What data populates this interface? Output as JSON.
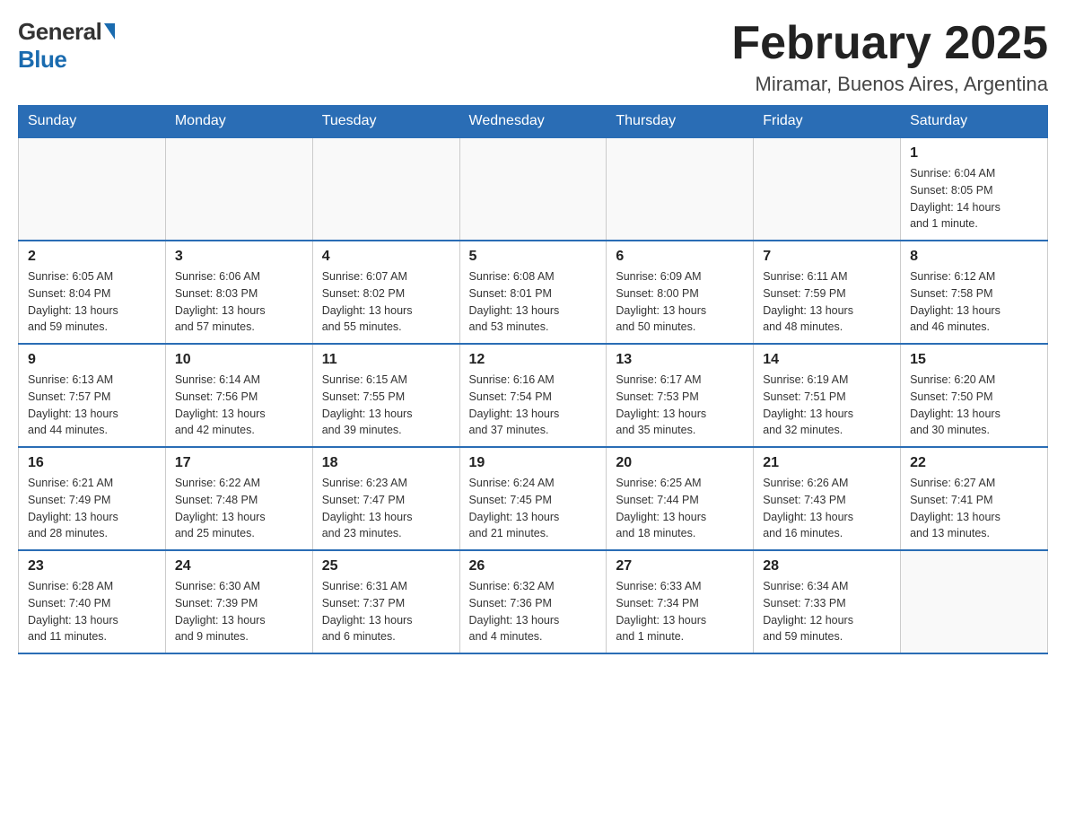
{
  "header": {
    "logo_general": "General",
    "logo_blue": "Blue",
    "month_title": "February 2025",
    "location": "Miramar, Buenos Aires, Argentina"
  },
  "days_of_week": [
    "Sunday",
    "Monday",
    "Tuesday",
    "Wednesday",
    "Thursday",
    "Friday",
    "Saturday"
  ],
  "weeks": [
    [
      {
        "day": "",
        "info": ""
      },
      {
        "day": "",
        "info": ""
      },
      {
        "day": "",
        "info": ""
      },
      {
        "day": "",
        "info": ""
      },
      {
        "day": "",
        "info": ""
      },
      {
        "day": "",
        "info": ""
      },
      {
        "day": "1",
        "info": "Sunrise: 6:04 AM\nSunset: 8:05 PM\nDaylight: 14 hours\nand 1 minute."
      }
    ],
    [
      {
        "day": "2",
        "info": "Sunrise: 6:05 AM\nSunset: 8:04 PM\nDaylight: 13 hours\nand 59 minutes."
      },
      {
        "day": "3",
        "info": "Sunrise: 6:06 AM\nSunset: 8:03 PM\nDaylight: 13 hours\nand 57 minutes."
      },
      {
        "day": "4",
        "info": "Sunrise: 6:07 AM\nSunset: 8:02 PM\nDaylight: 13 hours\nand 55 minutes."
      },
      {
        "day": "5",
        "info": "Sunrise: 6:08 AM\nSunset: 8:01 PM\nDaylight: 13 hours\nand 53 minutes."
      },
      {
        "day": "6",
        "info": "Sunrise: 6:09 AM\nSunset: 8:00 PM\nDaylight: 13 hours\nand 50 minutes."
      },
      {
        "day": "7",
        "info": "Sunrise: 6:11 AM\nSunset: 7:59 PM\nDaylight: 13 hours\nand 48 minutes."
      },
      {
        "day": "8",
        "info": "Sunrise: 6:12 AM\nSunset: 7:58 PM\nDaylight: 13 hours\nand 46 minutes."
      }
    ],
    [
      {
        "day": "9",
        "info": "Sunrise: 6:13 AM\nSunset: 7:57 PM\nDaylight: 13 hours\nand 44 minutes."
      },
      {
        "day": "10",
        "info": "Sunrise: 6:14 AM\nSunset: 7:56 PM\nDaylight: 13 hours\nand 42 minutes."
      },
      {
        "day": "11",
        "info": "Sunrise: 6:15 AM\nSunset: 7:55 PM\nDaylight: 13 hours\nand 39 minutes."
      },
      {
        "day": "12",
        "info": "Sunrise: 6:16 AM\nSunset: 7:54 PM\nDaylight: 13 hours\nand 37 minutes."
      },
      {
        "day": "13",
        "info": "Sunrise: 6:17 AM\nSunset: 7:53 PM\nDaylight: 13 hours\nand 35 minutes."
      },
      {
        "day": "14",
        "info": "Sunrise: 6:19 AM\nSunset: 7:51 PM\nDaylight: 13 hours\nand 32 minutes."
      },
      {
        "day": "15",
        "info": "Sunrise: 6:20 AM\nSunset: 7:50 PM\nDaylight: 13 hours\nand 30 minutes."
      }
    ],
    [
      {
        "day": "16",
        "info": "Sunrise: 6:21 AM\nSunset: 7:49 PM\nDaylight: 13 hours\nand 28 minutes."
      },
      {
        "day": "17",
        "info": "Sunrise: 6:22 AM\nSunset: 7:48 PM\nDaylight: 13 hours\nand 25 minutes."
      },
      {
        "day": "18",
        "info": "Sunrise: 6:23 AM\nSunset: 7:47 PM\nDaylight: 13 hours\nand 23 minutes."
      },
      {
        "day": "19",
        "info": "Sunrise: 6:24 AM\nSunset: 7:45 PM\nDaylight: 13 hours\nand 21 minutes."
      },
      {
        "day": "20",
        "info": "Sunrise: 6:25 AM\nSunset: 7:44 PM\nDaylight: 13 hours\nand 18 minutes."
      },
      {
        "day": "21",
        "info": "Sunrise: 6:26 AM\nSunset: 7:43 PM\nDaylight: 13 hours\nand 16 minutes."
      },
      {
        "day": "22",
        "info": "Sunrise: 6:27 AM\nSunset: 7:41 PM\nDaylight: 13 hours\nand 13 minutes."
      }
    ],
    [
      {
        "day": "23",
        "info": "Sunrise: 6:28 AM\nSunset: 7:40 PM\nDaylight: 13 hours\nand 11 minutes."
      },
      {
        "day": "24",
        "info": "Sunrise: 6:30 AM\nSunset: 7:39 PM\nDaylight: 13 hours\nand 9 minutes."
      },
      {
        "day": "25",
        "info": "Sunrise: 6:31 AM\nSunset: 7:37 PM\nDaylight: 13 hours\nand 6 minutes."
      },
      {
        "day": "26",
        "info": "Sunrise: 6:32 AM\nSunset: 7:36 PM\nDaylight: 13 hours\nand 4 minutes."
      },
      {
        "day": "27",
        "info": "Sunrise: 6:33 AM\nSunset: 7:34 PM\nDaylight: 13 hours\nand 1 minute."
      },
      {
        "day": "28",
        "info": "Sunrise: 6:34 AM\nSunset: 7:33 PM\nDaylight: 12 hours\nand 59 minutes."
      },
      {
        "day": "",
        "info": ""
      }
    ]
  ]
}
